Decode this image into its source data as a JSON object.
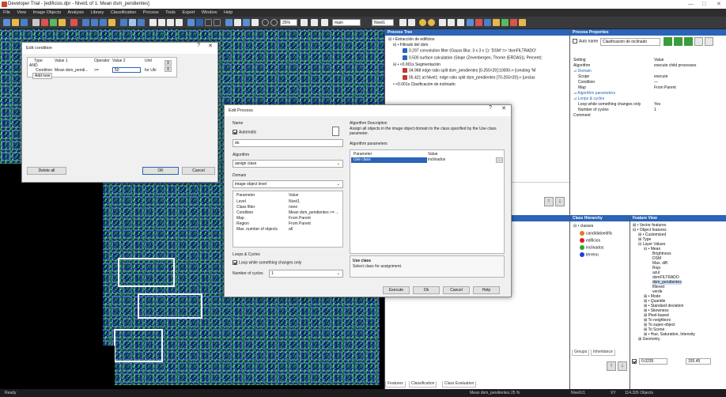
{
  "window": {
    "title": "Developer Trial - [edificios.dpr - Nivel1 of 1: Mean dsm_pendientes]",
    "min": "—",
    "max": "□",
    "close": "✕"
  },
  "menu": [
    "File",
    "View",
    "Image Objects",
    "Analysis",
    "Library",
    "Classification",
    "Process",
    "Tools",
    "Export",
    "Window",
    "Help"
  ],
  "toolbar": {
    "zoom": "25%",
    "layer": "main",
    "level": "Nivel1"
  },
  "process_tree": {
    "title": "Process Tree",
    "rows": [
      "⊟ • Extracción de edificios",
      "⊟ • Filtrado del dsm",
      "0.297  convolution filter (Gauss Blur, 3 x 3 x 1): 'DSM' => 'dsmFILTRADO'",
      "0.500  surface calculation (Slope (Zevenbergen, Thorne (ERDAS)), Percent):",
      "⊟ • <0.001s  Segmentación",
      "04.968  edge ratio split dsm_pendientes [0-255=20]:10000-> [creating 'Ni'",
      "05.421  at Nivel1: edge ratio split dsm_pendientes [70-255=20]-> [unclas",
      "• <0.001s  Clasificación de inclinado"
    ]
  },
  "process_props": {
    "title": "Process Properties",
    "auto_name": "Auto name",
    "name_value": "Clasificación de inclinado",
    "col_setting": "Setting",
    "col_value": "Value",
    "rows": [
      [
        "Algorithm",
        "execute child processes"
      ],
      [
        "⊿ Domain",
        ""
      ],
      [
        "Scope",
        "execute"
      ],
      [
        "Condition",
        "—"
      ],
      [
        "Map",
        "From Parent"
      ],
      [
        "⊿ Algorithm parameters",
        ""
      ],
      [
        "⊿ Loops & cycles",
        ""
      ],
      [
        "Loop while something changes only",
        "Yes"
      ],
      [
        "Number of cycles",
        "1"
      ],
      [
        "Comment",
        ""
      ]
    ]
  },
  "class_hierarchy": {
    "title": "Class Hierarchy",
    "root": "⊟ • classes",
    "classes": [
      {
        "name": "candidatoedific",
        "color": "#e07a1f"
      },
      {
        "name": "edificios",
        "color": "#d8201f"
      },
      {
        "name": "inclinados",
        "color": "#2aa52a"
      },
      {
        "name": "terreno",
        "color": "#1f3fd8"
      }
    ],
    "tab_groups": "Groups",
    "tab_inheritance": "Inheritance"
  },
  "feature_view": {
    "title": "Feature View",
    "rows": [
      "⊞ • Vector features",
      "⊟ • Object features",
      "⊞ • Customized",
      "⊞ Type",
      "⊟ Layer Values",
      "⊟ • Mean",
      "Brightness",
      "DSM",
      "Max. diff.",
      "Rojo",
      "azul",
      "dsmFILTRADO",
      "dsm_pendientes",
      "filtered",
      "verde",
      "⊞ • Mode",
      "⊞ • Quantile",
      "⊞ • Standard deviation",
      "⊞ • Skewness",
      "⊞ Pixel-based",
      "⊞ To neighbors",
      "⊞ To super-object",
      "⊞ To Scene",
      "⊞ • Hue, Saturation, Intensity",
      "⊞ Geometry"
    ],
    "range_min": "0.0235",
    "range_max": "155.45"
  },
  "bottom_tabs": [
    "Features",
    "Classification",
    "Class Evaluation"
  ],
  "edit_condition": {
    "title": "Edit condition",
    "help": "?",
    "close": "✕",
    "headers": [
      "Type",
      "Value 1",
      "Operator",
      "Value 2",
      "Unit"
    ],
    "and_label": "AND",
    "condition_label": "Condition",
    "condition_value1": "Mean dsm_pendi...",
    "operator": ">=",
    "value2": "50",
    "unit": "for Uki",
    "add_new": "Add new",
    "delete_all": "Delete all",
    "ok": "OK",
    "cancel": "Cancel",
    "x1": "X",
    "x2": "X"
  },
  "edit_process": {
    "title": "Edit Process",
    "help": "?",
    "close": "✕",
    "name_label": "Name",
    "automatic": "Automatic",
    "name_value": "do",
    "algorithm_label": "Algorithm",
    "algorithm_value": "assign class",
    "domain_label": "Domain",
    "domain_value": "image object level",
    "param_header": "Parameter",
    "value_header": "Value",
    "params": [
      [
        "Level",
        "Nivel1"
      ],
      [
        "Class filter",
        "none"
      ],
      [
        "Condition",
        "Mean dsm_pendientes >= ..."
      ],
      [
        "Map",
        "From Parent"
      ],
      [
        "Region",
        "From Parent"
      ],
      [
        "Max. number of objects",
        "all"
      ]
    ],
    "loops_label": "Loops & Cycles",
    "loop_while": "Loop while something changes only",
    "cycles_label": "Number of cycles",
    "cycles_value": "1",
    "desc_label": "Algorithm Description",
    "desc_text": "Assign all objects in the image object domain to the class specified by the Use class parameter.",
    "alg_params_label": "Algorithm parameters",
    "ap_param": "Parameter",
    "ap_value": "Value",
    "ap_row_param": "Use class",
    "ap_row_value": "inclinados",
    "use_class_title": "Use class",
    "use_class_desc": "Select class for assignment.",
    "execute": "Execute",
    "ok": "Ok",
    "cancel": "Cancel",
    "help_btn": "Help"
  },
  "status": {
    "left": "Ready",
    "mid": "Mean dsm_pendientes   25 %",
    "level": "Nivel1/1",
    "xy": "XY",
    "objects": "114.326 Objects"
  }
}
